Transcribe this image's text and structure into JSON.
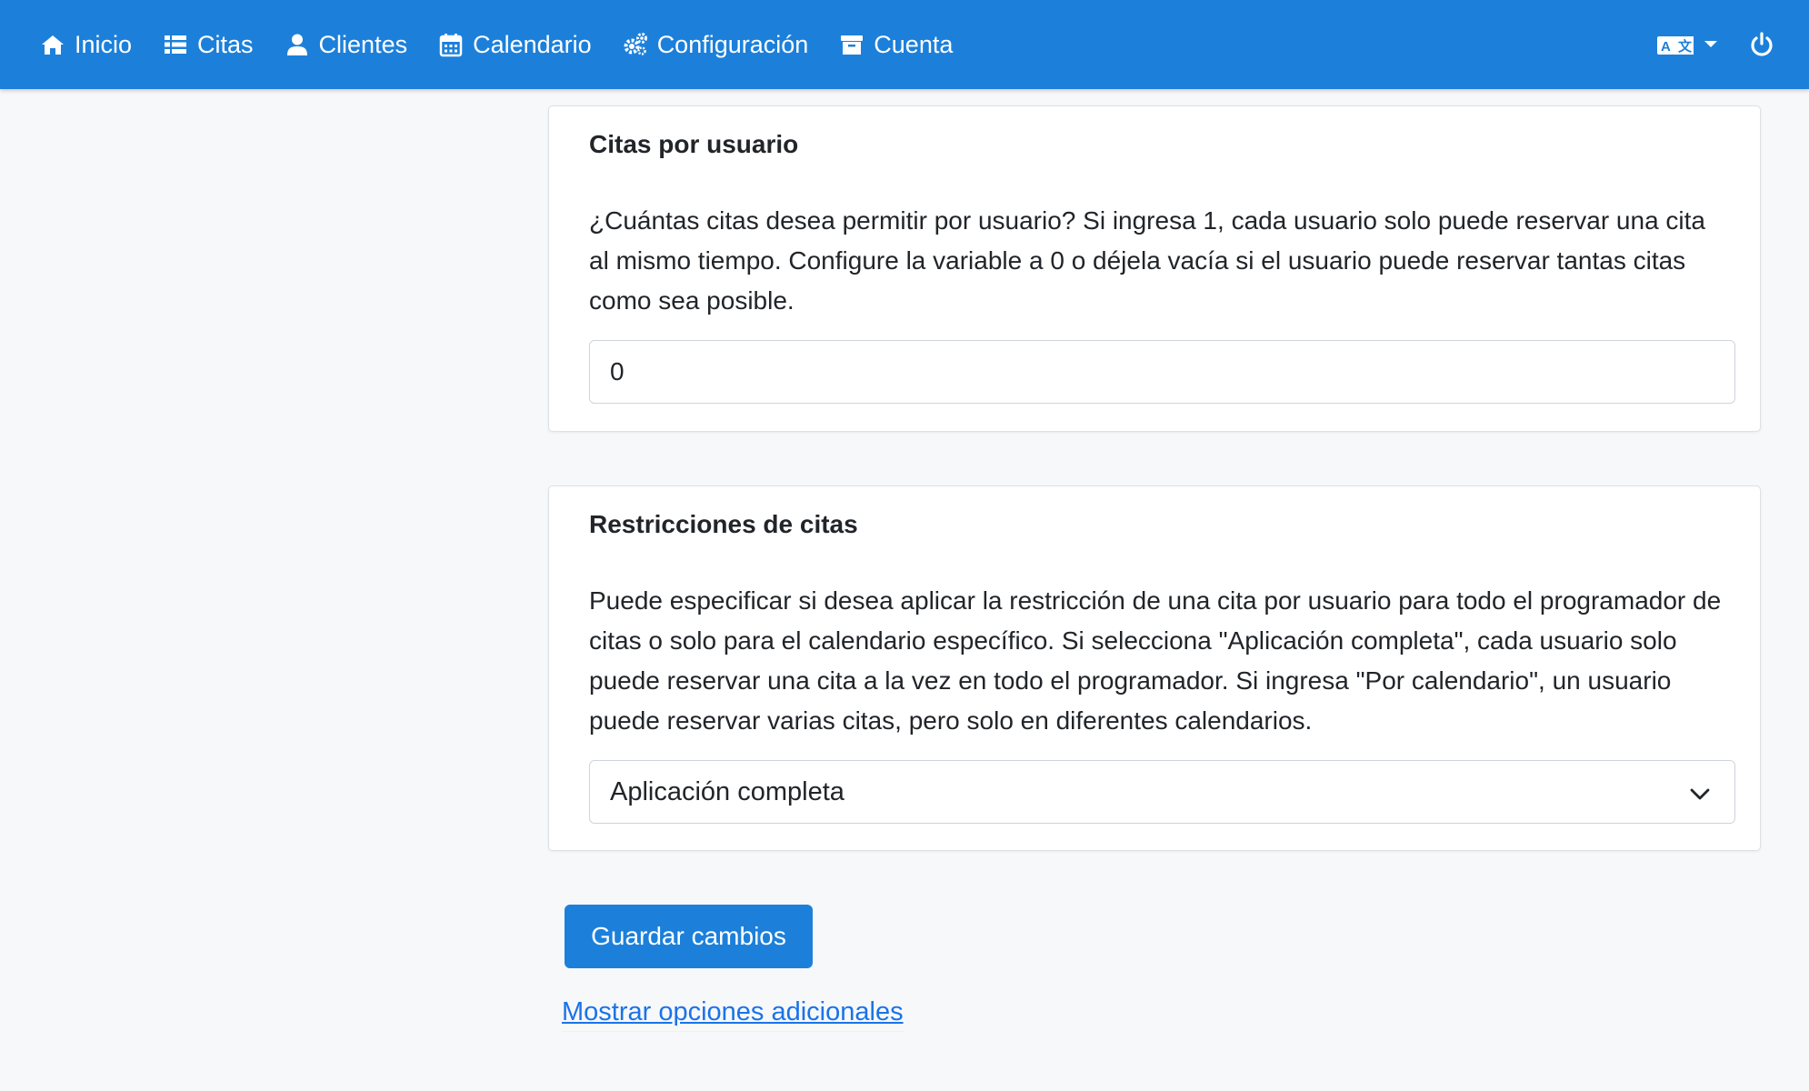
{
  "navbar": {
    "items": [
      {
        "label": "Inicio",
        "icon": "home-icon"
      },
      {
        "label": "Citas",
        "icon": "list-icon"
      },
      {
        "label": "Clientes",
        "icon": "user-icon"
      },
      {
        "label": "Calendario",
        "icon": "calendar-icon"
      },
      {
        "label": "Configuración",
        "icon": "gears-icon"
      },
      {
        "label": "Cuenta",
        "icon": "archive-icon"
      }
    ],
    "right_icons": [
      "language-icon",
      "power-icon"
    ],
    "background_color": "#1c80da"
  },
  "appointments_per_user": {
    "title": "Citas por usuario",
    "description": "¿Cuántas citas desea permitir por usuario? Si ingresa 1, cada usuario solo puede reservar una cita al mismo tiempo. Configure la variable a 0 o déjela vacía si el usuario puede reservar tantas citas como sea posible.",
    "value": "0"
  },
  "appointment_restrictions": {
    "title": "Restricciones de citas",
    "description": "Puede especificar si desea aplicar la restricción de una cita por usuario para todo el programador de citas o solo para el calendario específico. Si selecciona \"Aplicación completa\", cada usuario solo puede reservar una cita a la vez en todo el programador. Si ingresa \"Por calendario\", un usuario puede reservar varias citas, pero solo en diferentes calendarios.",
    "selected": "Aplicación completa"
  },
  "actions": {
    "save_label": "Guardar cambios",
    "more_options_label": "Mostrar opciones adicionales"
  }
}
